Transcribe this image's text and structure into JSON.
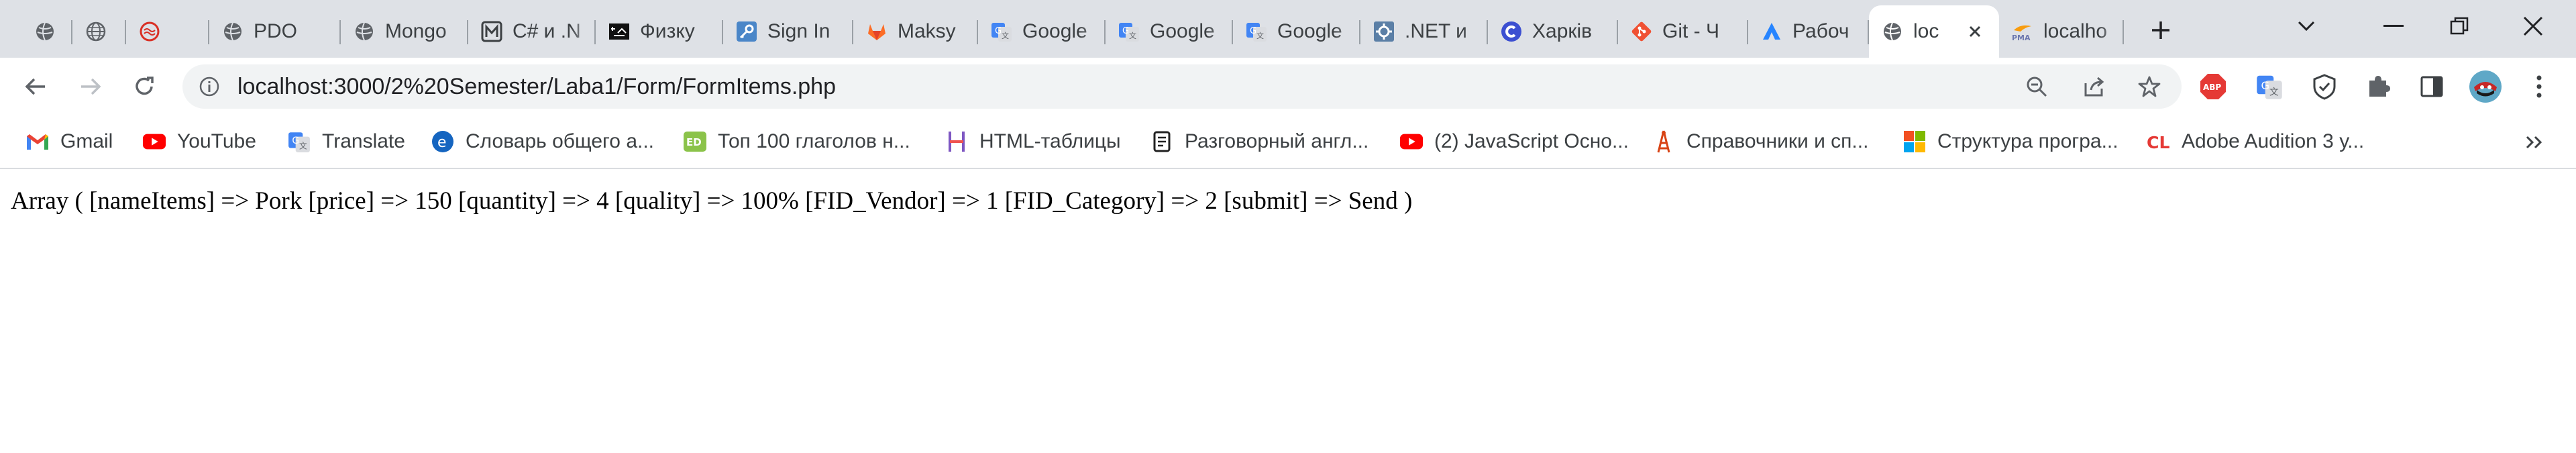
{
  "tabs": [
    {
      "title": "",
      "icon": "globe-icon"
    },
    {
      "title": "",
      "icon": "globe-grid-icon"
    },
    {
      "title": "",
      "icon": "no-sign-icon"
    },
    {
      "title": "PDO",
      "icon": "globe-icon"
    },
    {
      "title": "Mongo",
      "icon": "globe-icon"
    },
    {
      "title": "C# и .N",
      "icon": "m-logo-icon"
    },
    {
      "title": "Физку",
      "icon": "dark-site-icon"
    },
    {
      "title": "Sign In",
      "icon": "key-icon"
    },
    {
      "title": "Maksy",
      "icon": "gitlab-icon"
    },
    {
      "title": "Google",
      "icon": "google-translate-icon"
    },
    {
      "title": "Google",
      "icon": "google-translate-icon"
    },
    {
      "title": "Google",
      "icon": "google-translate-icon"
    },
    {
      "title": ".NET и",
      "icon": "gear-box-icon"
    },
    {
      "title": "Харків",
      "icon": "c-logo-icon"
    },
    {
      "title": "Git - Ч",
      "icon": "git-icon"
    },
    {
      "title": "Рабоч",
      "icon": "jira-icon"
    },
    {
      "title": "loc",
      "icon": "globe-icon",
      "active": true
    },
    {
      "title": "localho",
      "icon": "phpmyadmin-icon"
    }
  ],
  "address": {
    "url": "localhost:3000/2%20Semester/Laba1/Form/FormItems.php"
  },
  "bookmarks": [
    {
      "label": "Gmail",
      "icon": "gmail-icon"
    },
    {
      "label": "YouTube",
      "icon": "youtube-icon"
    },
    {
      "label": "Translate",
      "icon": "google-translate-icon"
    },
    {
      "label": "Словарь общего а...",
      "icon": "e-logo-icon"
    },
    {
      "label": "Топ 100 глаголов н...",
      "icon": "ed-icon"
    },
    {
      "label": "HTML-таблицы",
      "icon": "h-logo-icon"
    },
    {
      "label": "Разговорный англ...",
      "icon": "scroll-icon"
    },
    {
      "label": "(2) JavaScript Осно...",
      "icon": "youtube-icon"
    },
    {
      "label": "Справочники и сп...",
      "icon": "tower-icon"
    },
    {
      "label": "Структура програ...",
      "icon": "microsoft-icon"
    },
    {
      "label": "Adobe Audition 3 у...",
      "icon": "cl-logo-icon"
    }
  ],
  "content": {
    "output": "Array ( [nameItems] => Pork [price] => 150 [quantity] => 4 [quality] => 100% [FID_Vendor] => 1 [FID_Category] => 2 [submit] => Send )"
  },
  "colors": {
    "tabstrip_bg": "#dee1e6",
    "omnibox_bg": "#f1f3f4",
    "youtube_red": "#ff0000",
    "gitlab_orange": "#fc6d26",
    "google_blue": "#4285f4"
  }
}
